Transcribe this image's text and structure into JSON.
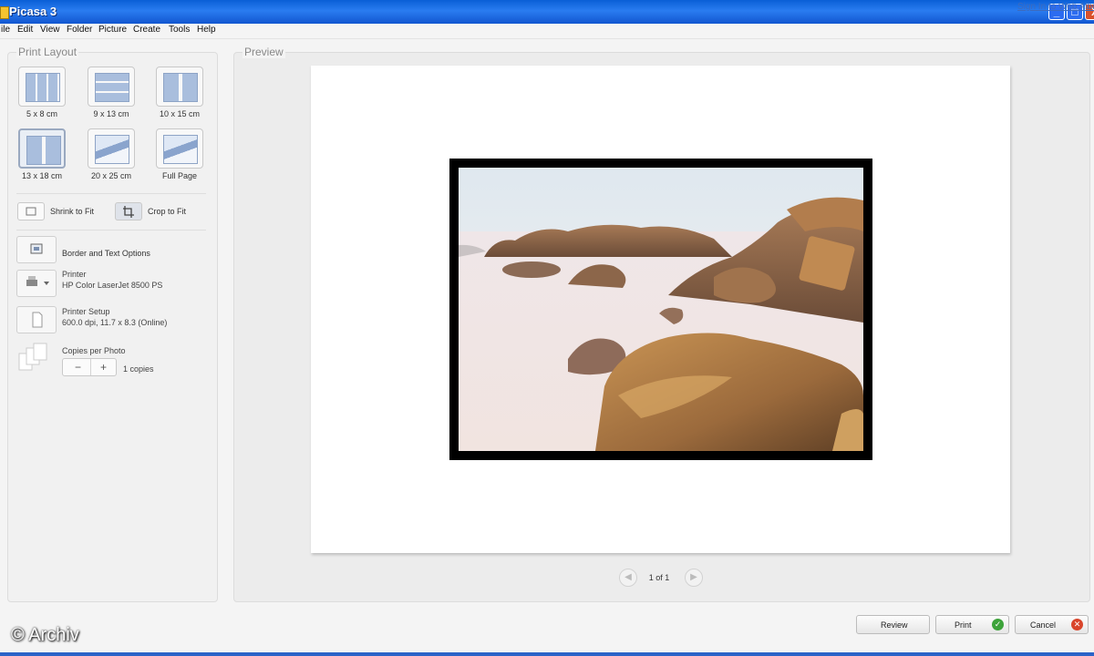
{
  "window": {
    "title": "Picasa 3",
    "minimize": "_",
    "maximize": "□",
    "close": "X"
  },
  "menu": {
    "items": [
      "ile",
      "Edit",
      "View",
      "Folder",
      "Picture",
      "Create",
      "Tools",
      "Help"
    ],
    "sign_in": "Sign In to Web Album"
  },
  "left_panel": {
    "title": "Print Layout",
    "layouts": [
      {
        "label": "5 x 8 cm",
        "selected": false
      },
      {
        "label": "9 x 13 cm",
        "selected": false
      },
      {
        "label": "10 x 15 cm",
        "selected": false
      },
      {
        "label": "13 x 18 cm",
        "selected": true
      },
      {
        "label": "20 x 25 cm",
        "selected": false
      },
      {
        "label": "Full Page",
        "selected": false
      }
    ],
    "shrink_to_fit": "Shrink to Fit",
    "crop_to_fit": "Crop to Fit",
    "border_text_options": "Border and Text Options",
    "printer_label": "Printer",
    "printer_name": "HP Color LaserJet 8500 PS",
    "printer_setup_label": "Printer Setup",
    "printer_setup_value": "600.0 dpi, 11.7 x 8.3 (Online)",
    "copies_label": "Copies per Photo",
    "copies_minus": "−",
    "copies_plus": "+",
    "copies_value": "1 copies"
  },
  "preview": {
    "title": "Preview",
    "page_indicator": "1 of 1"
  },
  "actions": {
    "review": "Review",
    "print": "Print",
    "cancel": "Cancel"
  },
  "watermark": "© Archiv",
  "colors": {
    "titlebar": "#1256d0",
    "print_ok": "#3da33a",
    "cancel_x": "#d9452b"
  }
}
